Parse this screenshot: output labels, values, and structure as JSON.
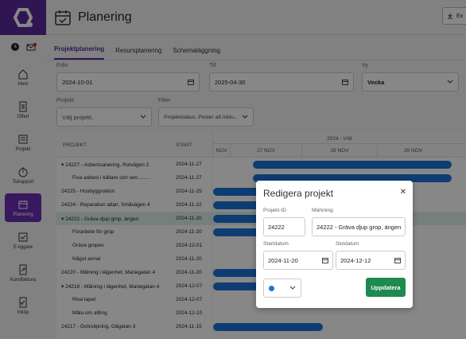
{
  "app": {
    "title": "Planering",
    "export_label": "Ex"
  },
  "sidebar": {
    "items": [
      {
        "label": "Hem"
      },
      {
        "label": "Offert"
      },
      {
        "label": "Projekt"
      },
      {
        "label": "Tidrapport"
      },
      {
        "label": "Planering"
      },
      {
        "label": "E-liggare"
      },
      {
        "label": "Kundfaktura"
      },
      {
        "label": "Inköp"
      }
    ]
  },
  "tabs": [
    {
      "label": "Projektplanering"
    },
    {
      "label": "Resursplanering"
    },
    {
      "label": "Schemaläggning"
    }
  ],
  "filters": {
    "from_label": "Från",
    "from_value": "2024-10-01",
    "to_label": "Till",
    "to_value": "2025-04-30",
    "view_label": "Vy",
    "view_value": "Vecka",
    "project_label": "Projekt",
    "project_placeholder": "Välj projekt..",
    "filter_label": "Filter",
    "filter_value": "Projektstatus, Poster att inklu..."
  },
  "grid": {
    "col_project": "PROJEKT",
    "col_start": "START",
    "week_label": "2024 - V48",
    "days": [
      "NOV",
      "27 NOV",
      "28 NOV",
      "29 NOV"
    ],
    "rows": [
      {
        "name": "24227 - Asbestsanering, Rotvägen 2",
        "start": "2024-11-27",
        "group": true
      },
      {
        "name": "Fixa asbest i källare och sen.........",
        "start": "2024-11-27",
        "group": false
      },
      {
        "name": "24225 - Husbyggnation",
        "start": "2024-11-25",
        "group": false,
        "top": true
      },
      {
        "name": "24224 - Reparation altan, Småvägen 4",
        "start": "2024-11-22",
        "group": false,
        "top": true
      },
      {
        "name": "24222 - Gräva djup grop, ängen",
        "start": "2024-11-20",
        "group": true,
        "selected": true
      },
      {
        "name": "Förarbete för grop",
        "start": "2024-11-20",
        "group": false
      },
      {
        "name": "Gräva gropen",
        "start": "2024-12-01",
        "group": false
      },
      {
        "name": "Något annat",
        "start": "2024-11-20",
        "group": false
      },
      {
        "name": "24220 - Målning i lägenhet, Mariegatan 4",
        "start": "2024-11-20",
        "group": false,
        "top": true
      },
      {
        "name": "24218 - Målning i lägenhet, Mariegatan 4",
        "start": "2024-12-07",
        "group": true
      },
      {
        "name": "Riva tapet",
        "start": "2024-12-07",
        "group": false
      },
      {
        "name": "Måla om allting",
        "start": "2024-12-10",
        "group": false
      },
      {
        "name": "24217 - Golvslipning, Gågatan 3",
        "start": "2024-11-15",
        "group": false,
        "top": true
      }
    ]
  },
  "modal": {
    "title": "Redigera projekt",
    "close": "✕",
    "id_label": "Projekt-ID",
    "id_value": "24222",
    "mark_label": "Märkning",
    "mark_value": "24222 - Gräva djup grop, ängen",
    "start_label": "Startdatum",
    "start_value": "2024-11-20",
    "end_label": "Slutdatum",
    "end_value": "2024-12-12",
    "color_value": "#1a73d9",
    "update_label": "Uppdatera"
  },
  "colors": {
    "brand": "#5a2a9e",
    "bar": "#1a73d9",
    "update": "#1e8a4e"
  }
}
